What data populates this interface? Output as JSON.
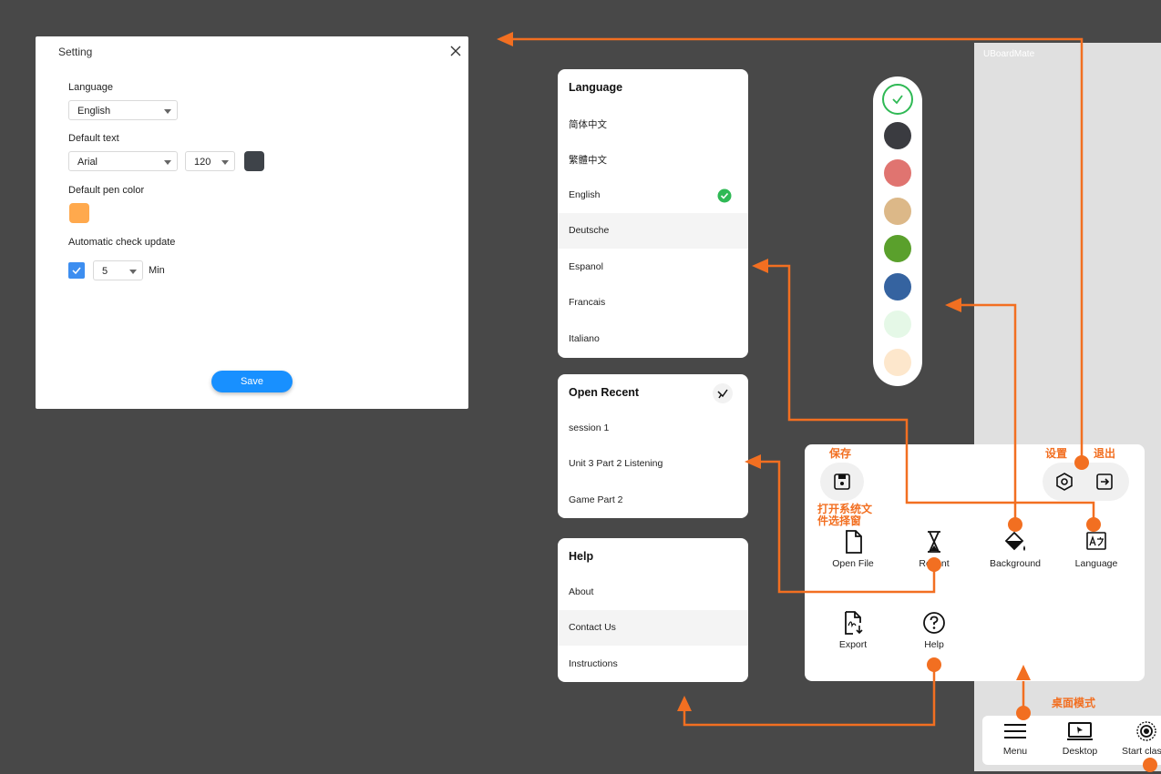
{
  "setting": {
    "title": "Setting",
    "language_label": "Language",
    "language_value": "English",
    "default_text_label": "Default text",
    "font_value": "Arial",
    "size_value": "120",
    "pen_color_label": "Default pen color",
    "update_label": "Automatic check update",
    "update_interval": "5",
    "update_unit": "Min",
    "save_label": "Save",
    "text_color": "#3e4349",
    "pen_color": "#ffa94d"
  },
  "language_panel": {
    "title": "Language",
    "items": [
      "简体中文",
      "繁體中文",
      "English",
      "Deutsche",
      "Espanol",
      "Francais",
      "Italiano"
    ]
  },
  "recent_panel": {
    "title": "Open Recent",
    "items": [
      "session 1",
      "Unit 3 Part 2 Listening",
      "Game Part 2"
    ]
  },
  "help_panel": {
    "title": "Help",
    "items": [
      "About",
      "Contact Us",
      "Instructions"
    ]
  },
  "colors": [
    "#ffffff",
    "#3a3b40",
    "#e07470",
    "#dcb888",
    "#5aa02c",
    "#3563a0",
    "#e5f8e7",
    "#fde7cc"
  ],
  "board": {
    "brand": "UBoardMate"
  },
  "menu": {
    "items": [
      "Open File",
      "Recent",
      "Background",
      "Language",
      "Export",
      "Help"
    ]
  },
  "bottombar": {
    "items": [
      "Menu",
      "Desktop",
      "Start clas"
    ]
  },
  "annotations": {
    "save": "保存",
    "open_dialog_1": "打开系统文",
    "open_dialog_2": "件选择窗",
    "settings": "设置",
    "exit": "退出",
    "desktop_mode": "桌面模式"
  },
  "accent": "#f26f21"
}
